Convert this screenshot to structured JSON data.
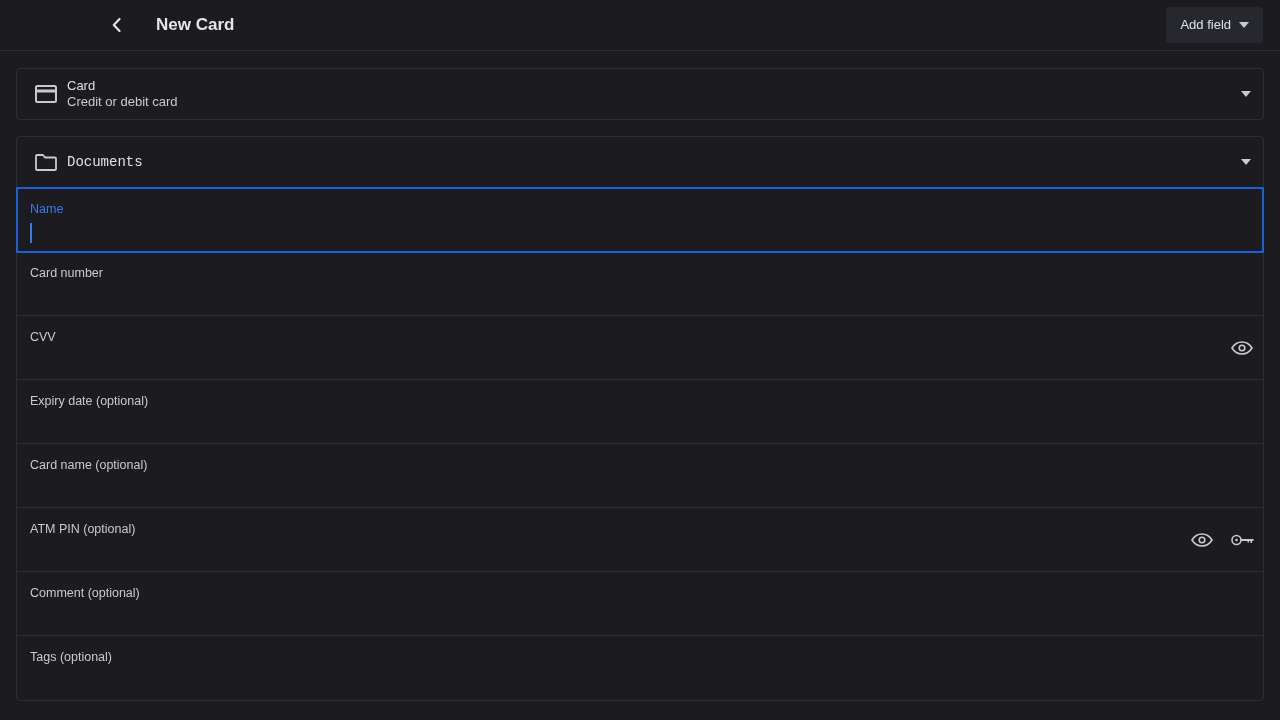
{
  "header": {
    "title": "New Card",
    "add_field_button": "Add field"
  },
  "type_selector": {
    "title": "Card",
    "subtitle": "Credit or debit card"
  },
  "folder_selector": {
    "label": "Documents"
  },
  "fields": [
    {
      "label": "Name",
      "kind": "text",
      "focused": true
    },
    {
      "label": "Card number",
      "kind": "text",
      "focused": false
    },
    {
      "label": "CVV",
      "kind": "secret",
      "focused": false
    },
    {
      "label": "Expiry date (optional)",
      "kind": "text",
      "focused": false
    },
    {
      "label": "Card name (optional)",
      "kind": "text",
      "focused": false
    },
    {
      "label": "ATM PIN (optional)",
      "kind": "pin",
      "focused": false
    },
    {
      "label": "Comment (optional)",
      "kind": "text",
      "focused": false
    },
    {
      "label": "Tags (optional)",
      "kind": "text",
      "focused": false
    }
  ]
}
